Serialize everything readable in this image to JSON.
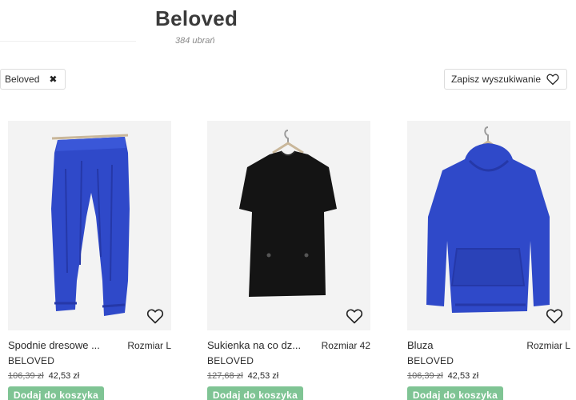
{
  "header": {
    "title": "Beloved",
    "count": "384 ubrań"
  },
  "filters": {
    "chip_label": "Beloved",
    "save_search_label": "Zapisz wyszukiwanie"
  },
  "products": [
    {
      "name": "Spodnie dresowe ...",
      "size": "Rozmiar L",
      "brand": "BELOVED",
      "old_price": "106,39 zł",
      "new_price": "42,53 zł",
      "cta": "Dodaj do koszyka",
      "color": "#2f49c9"
    },
    {
      "name": "Sukienka na co dz...",
      "size": "Rozmiar 42",
      "brand": "BELOVED",
      "old_price": "127,68 zł",
      "new_price": "42,53 zł",
      "cta": "Dodaj do koszyka",
      "color": "#141414"
    },
    {
      "name": "Bluza",
      "size": "Rozmiar L",
      "brand": "BELOVED",
      "old_price": "106,39 zł",
      "new_price": "42,53 zł",
      "cta": "Dodaj do koszyka",
      "color": "#2f49c9"
    }
  ],
  "colors": {
    "accent_button": "#7fc494",
    "photo_bg": "#f3f3f3"
  }
}
